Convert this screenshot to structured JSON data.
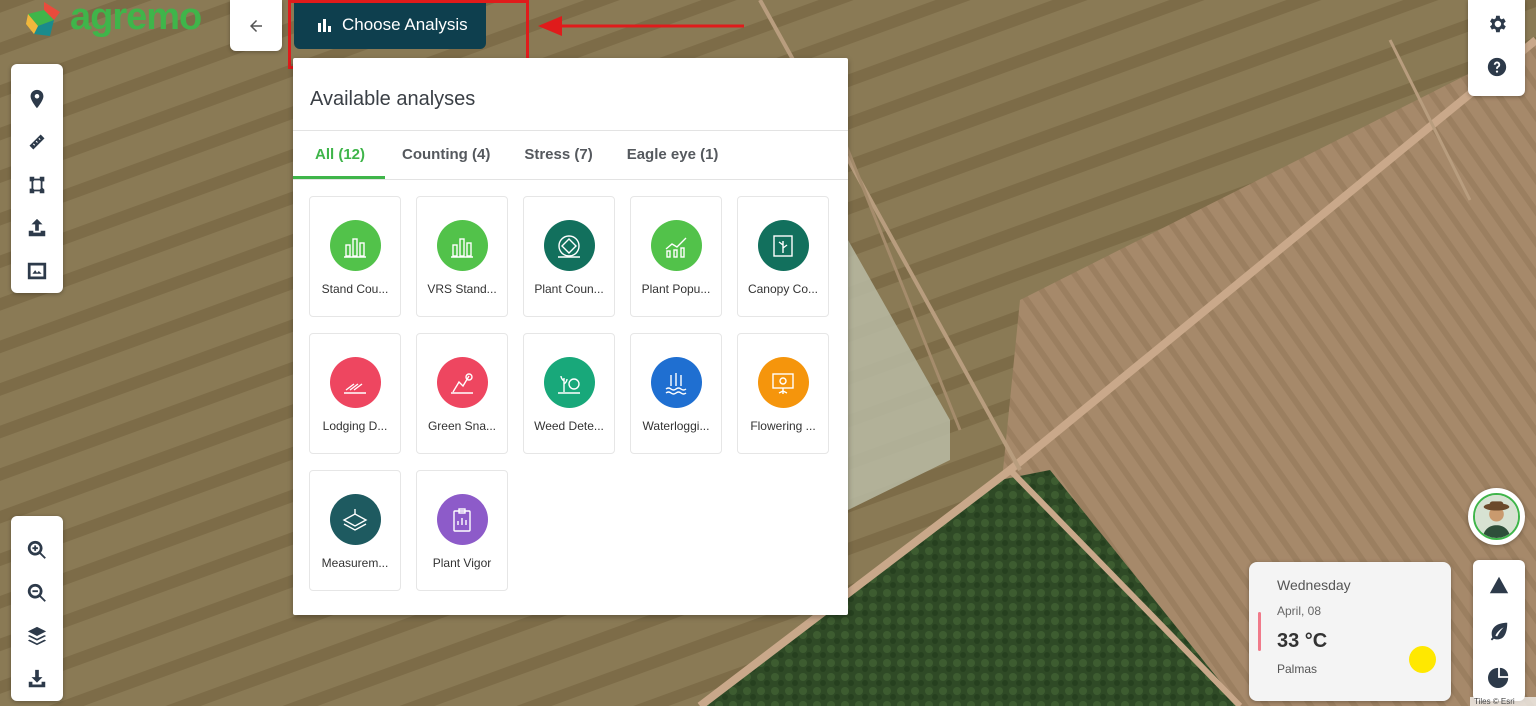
{
  "logo": {
    "text": "agremo"
  },
  "toolbar": {
    "choose_analysis_label": "Choose Analysis"
  },
  "panel": {
    "title": "Available analyses",
    "tabs": [
      {
        "label": "All (12)",
        "active": true
      },
      {
        "label": "Counting (4)",
        "active": false
      },
      {
        "label": "Stress (7)",
        "active": false
      },
      {
        "label": "Eagle eye (1)",
        "active": false
      }
    ],
    "analyses": [
      {
        "label": "Stand Cou...",
        "color": "#52c24a",
        "icon": "bar-crops-icon"
      },
      {
        "label": "VRS Stand...",
        "color": "#52c24a",
        "icon": "bar-crops-icon"
      },
      {
        "label": "Plant Coun...",
        "color": "#12705d",
        "icon": "plant-count-icon"
      },
      {
        "label": "Plant Popu...",
        "color": "#52c24a",
        "icon": "population-chart-icon"
      },
      {
        "label": "Canopy Co...",
        "color": "#12705d",
        "icon": "canopy-icon"
      },
      {
        "label": "Lodging D...",
        "color": "#ee4660",
        "icon": "lodging-icon"
      },
      {
        "label": "Green Sna...",
        "color": "#ee4660",
        "icon": "green-snap-icon"
      },
      {
        "label": "Weed Dete...",
        "color": "#18a87a",
        "icon": "weed-icon"
      },
      {
        "label": "Waterloggi...",
        "color": "#1f6fd1",
        "icon": "waterlogging-icon"
      },
      {
        "label": "Flowering ...",
        "color": "#f5950c",
        "icon": "flowering-icon"
      },
      {
        "label": "Measurem...",
        "color": "#1e5a60",
        "icon": "measurement-icon"
      },
      {
        "label": "Plant Vigor",
        "color": "#8d5bc9",
        "icon": "plant-vigor-icon"
      }
    ]
  },
  "weather": {
    "day": "Wednesday",
    "date": "April, 08",
    "temperature": "33 °C",
    "city": "Palmas"
  },
  "attribution": "Tiles © Esri",
  "colors": {
    "brand_green": "#3fb54a",
    "choose_button_bg": "#0e3f4e",
    "highlight_red": "#e01b1b"
  }
}
